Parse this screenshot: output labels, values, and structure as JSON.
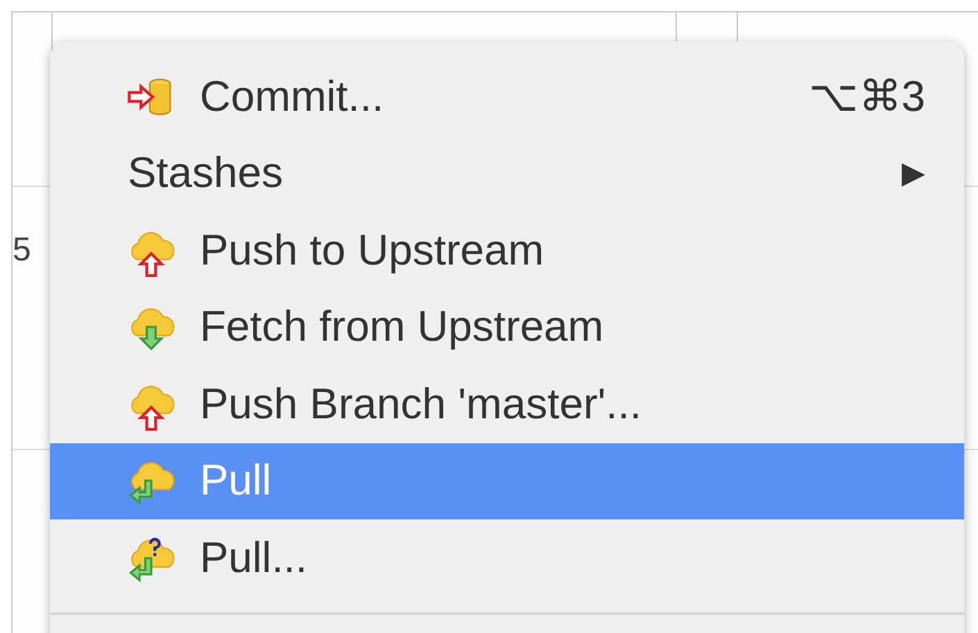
{
  "background": {
    "row_label": "5"
  },
  "menu": {
    "items": [
      {
        "kind": "commit",
        "label": "Commit...",
        "shortcut": "⌥⌘3",
        "selected": false
      },
      {
        "kind": "submenu",
        "label": "Stashes",
        "arrow": "▶",
        "selected": false
      },
      {
        "kind": "push",
        "label": "Push to Upstream",
        "selected": false
      },
      {
        "kind": "fetch",
        "label": "Fetch from Upstream",
        "selected": false
      },
      {
        "kind": "push",
        "label": "Push Branch 'master'...",
        "selected": false
      },
      {
        "kind": "pull",
        "label": "Pull",
        "selected": true
      },
      {
        "kind": "pulldialog",
        "label": "Pull...",
        "selected": false
      }
    ]
  }
}
